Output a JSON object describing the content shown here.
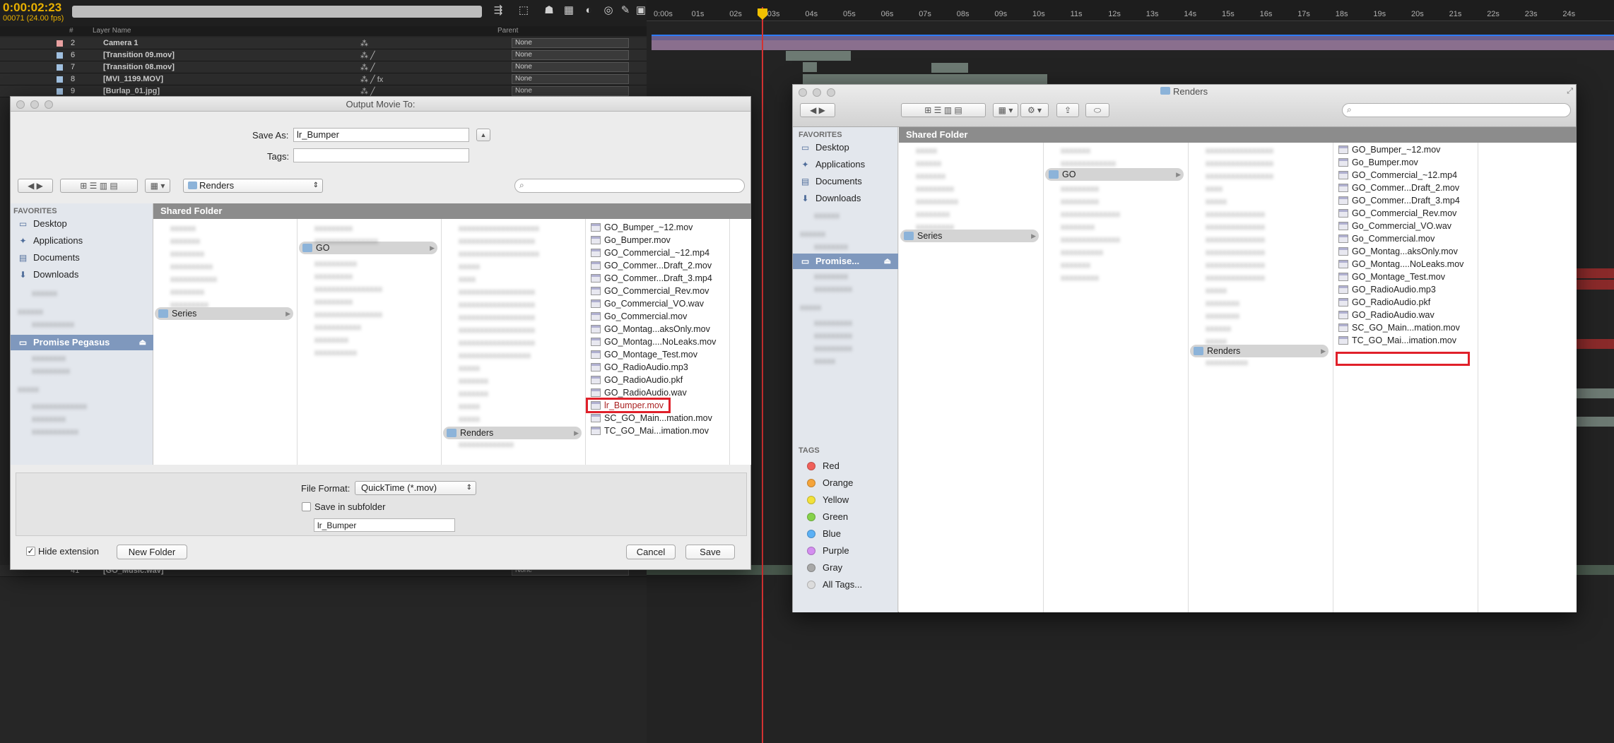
{
  "ae": {
    "timecode": "0:00:02:23",
    "fps": "00071 (24.00 fps)",
    "header": {
      "num": "#",
      "layer_name": "Layer Name",
      "parent": "Parent"
    },
    "layers": [
      {
        "num": "2",
        "name": "Camera 1",
        "parent": "None",
        "color": "#e8a0a0"
      },
      {
        "num": "6",
        "name": "[Transition 09.mov]",
        "parent": "None",
        "color": "#a0c0e0"
      },
      {
        "num": "7",
        "name": "[Transition 08.mov]",
        "parent": "None",
        "color": "#a0c0e0"
      },
      {
        "num": "8",
        "name": "[MVI_1199.MOV]",
        "parent": "None",
        "color": "#a0c0e0"
      },
      {
        "num": "9",
        "name": "[Burlap_01.jpg]",
        "parent": "None",
        "color": "#a0c0e0"
      }
    ],
    "bottom_layer": {
      "num": "41",
      "name": "[GO_Music.wav]",
      "parent": "None"
    },
    "ruler_ticks": [
      "0:00s",
      "01s",
      "02s",
      "03s",
      "04s",
      "05s",
      "06s",
      "07s",
      "08s",
      "09s",
      "10s",
      "11s",
      "12s",
      "13s",
      "14s",
      "15s",
      "16s",
      "17s",
      "18s",
      "19s",
      "20s",
      "21s",
      "22s",
      "23s",
      "24s"
    ]
  },
  "save_dialog": {
    "title": "Output Movie To:",
    "save_as_label": "Save As:",
    "save_as_value": "lr_Bumper",
    "tags_label": "Tags:",
    "location": "Renders",
    "path_title": "Shared Folder",
    "sidebar": {
      "favorites_header": "FAVORITES",
      "favorites": [
        "Desktop",
        "Applications",
        "Documents",
        "Downloads"
      ],
      "device": "Promise Pegasus"
    },
    "col2": [
      {
        "label": "Series",
        "selected": true
      }
    ],
    "col3": [
      {
        "label": "GO",
        "selected": true
      }
    ],
    "col4": [
      {
        "label": "Renders",
        "selected": true
      }
    ],
    "files": [
      "GO_Bumper_~12.mov",
      "Go_Bumper.mov",
      "GO_Commercial_~12.mp4",
      "GO_Commer...Draft_2.mov",
      "GO_Commer...Draft_3.mp4",
      "GO_Commercial_Rev.mov",
      "Go_Commercial_VO.wav",
      "Go_Commercial.mov",
      "GO_Montag...aksOnly.mov",
      "GO_Montag....NoLeaks.mov",
      "GO_Montage_Test.mov",
      "GO_RadioAudio.mp3",
      "GO_RadioAudio.pkf",
      "GO_RadioAudio.wav",
      "lr_Bumper.mov",
      "SC_GO_Main...mation.mov",
      "TC_GO_Mai...imation.mov"
    ],
    "highlighted_file": "lr_Bumper.mov",
    "file_format_label": "File Format:",
    "file_format_value": "QuickTime (*.mov)",
    "subfolder_label": "Save in subfolder",
    "subfolder_value": "lr_Bumper",
    "hide_ext_label": "Hide extension",
    "new_folder": "New Folder",
    "cancel": "Cancel",
    "save": "Save"
  },
  "finder": {
    "title": "Renders",
    "path_title": "Shared Folder",
    "sidebar": {
      "favorites_header": "FAVORITES",
      "favorites": [
        "Desktop",
        "Applications",
        "Documents",
        "Downloads"
      ],
      "device": "Promise...",
      "tags_header": "TAGS",
      "tags": [
        {
          "label": "Red",
          "color": "#f0605a"
        },
        {
          "label": "Orange",
          "color": "#f5a43a"
        },
        {
          "label": "Yellow",
          "color": "#f2e13a"
        },
        {
          "label": "Green",
          "color": "#86d24a"
        },
        {
          "label": "Blue",
          "color": "#5bb0f5"
        },
        {
          "label": "Purple",
          "color": "#d48ef0"
        },
        {
          "label": "Gray",
          "color": "#a8a8a8"
        },
        {
          "label": "All Tags...",
          "color": "#dcdcdc"
        }
      ]
    },
    "col1": [
      {
        "label": "Series",
        "selected": true
      }
    ],
    "col2": [
      {
        "label": "GO",
        "selected": true
      }
    ],
    "col3": [
      {
        "label": "Renders",
        "selected": true
      }
    ],
    "files": [
      "GO_Bumper_~12.mov",
      "Go_Bumper.mov",
      "GO_Commercial_~12.mp4",
      "GO_Commer...Draft_2.mov",
      "GO_Commer...Draft_3.mp4",
      "GO_Commercial_Rev.mov",
      "Go_Commercial_VO.wav",
      "Go_Commercial.mov",
      "GO_Montag...aksOnly.mov",
      "GO_Montag....NoLeaks.mov",
      "GO_Montage_Test.mov",
      "GO_RadioAudio.mp3",
      "GO_RadioAudio.pkf",
      "GO_RadioAudio.wav",
      "SC_GO_Main...mation.mov",
      "TC_GO_Mai...imation.mov"
    ]
  }
}
